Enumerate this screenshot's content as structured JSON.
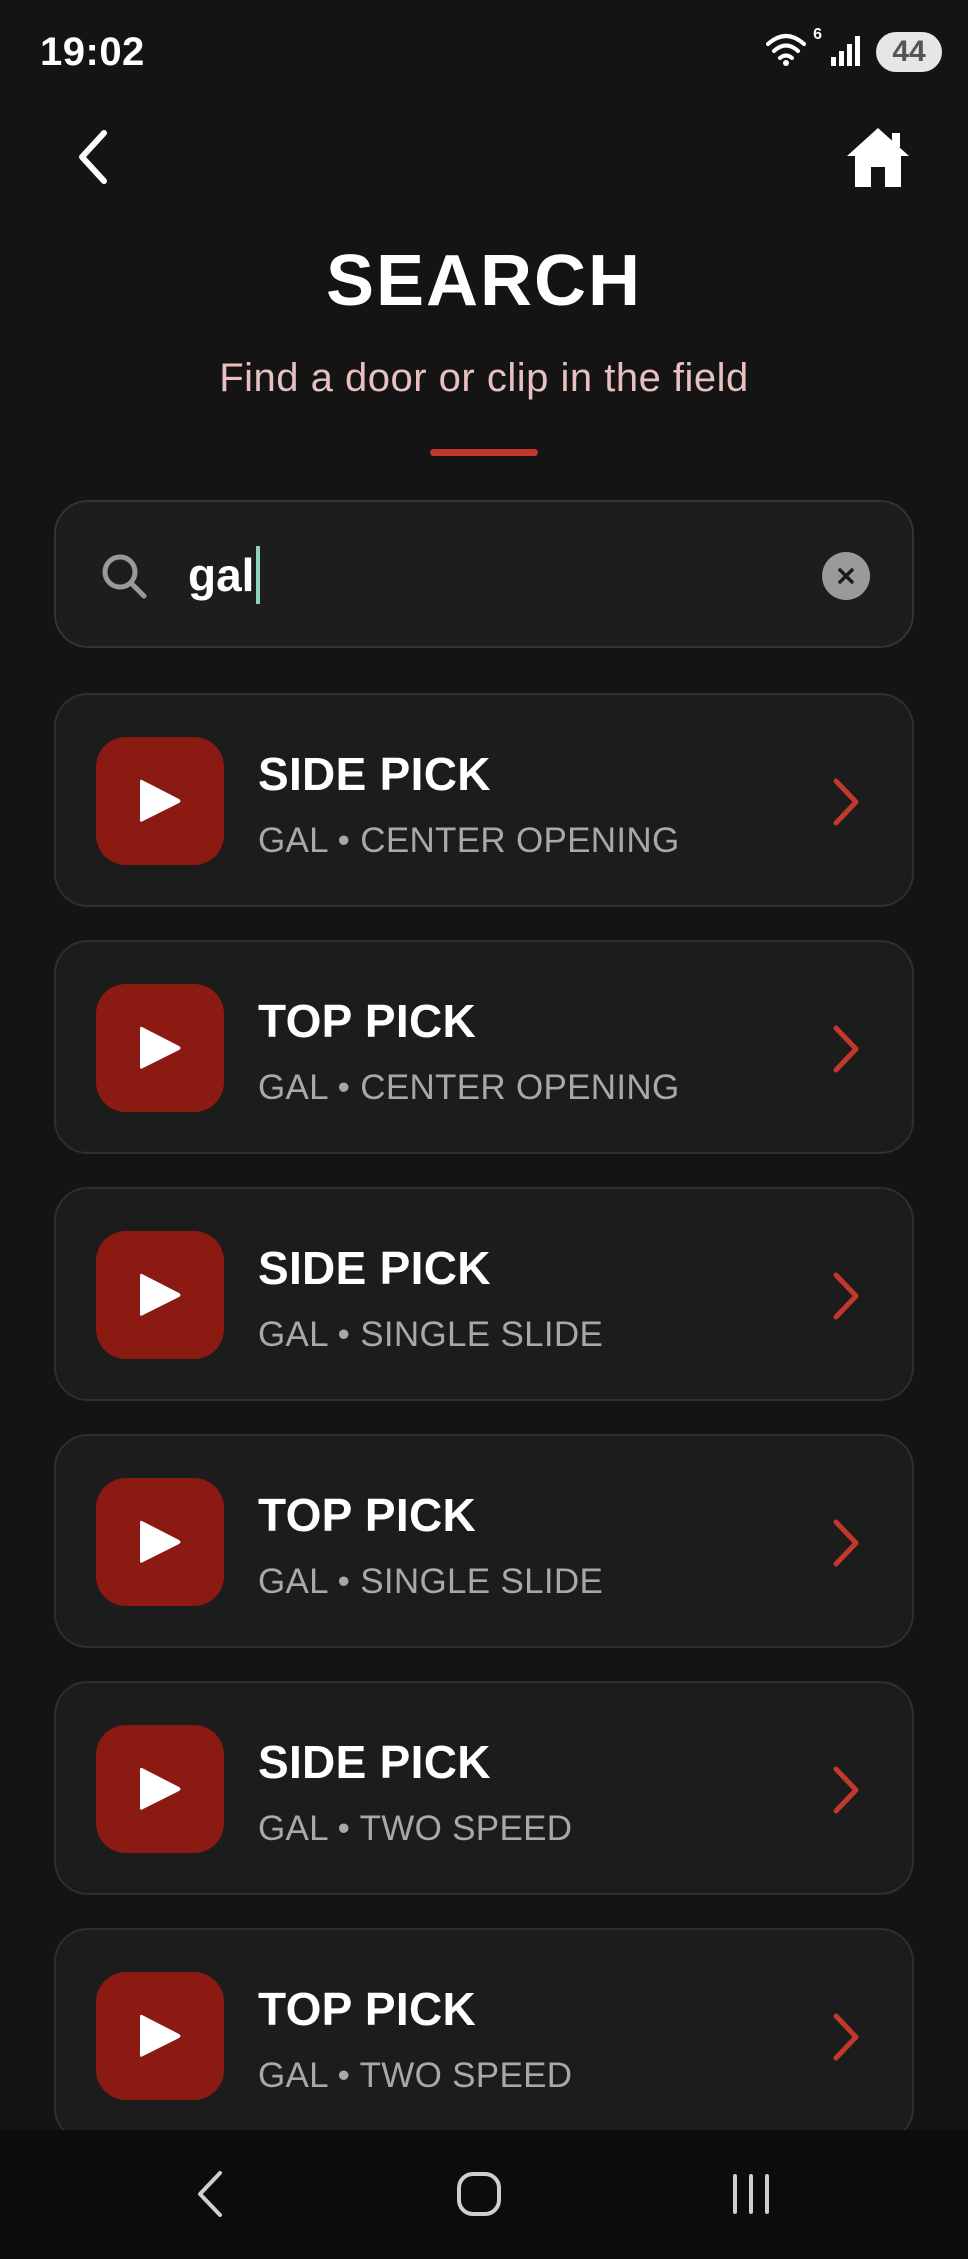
{
  "status_bar": {
    "time": "19:02",
    "wifi_superscript": "6",
    "battery": "44"
  },
  "header": {
    "title": "SEARCH",
    "subtitle": "Find a door or clip in the field",
    "accent_color": "#c0392b"
  },
  "search": {
    "value": "gal",
    "icon": "search-icon",
    "clear_icon": "clear-icon"
  },
  "results": [
    {
      "title": "SIDE PICK",
      "subtitle": "GAL • CENTER OPENING"
    },
    {
      "title": "TOP PICK",
      "subtitle": "GAL • CENTER OPENING"
    },
    {
      "title": "SIDE PICK",
      "subtitle": "GAL • SINGLE SLIDE"
    },
    {
      "title": "TOP PICK",
      "subtitle": "GAL • SINGLE SLIDE"
    },
    {
      "title": "SIDE PICK",
      "subtitle": "GAL • TWO SPEED"
    },
    {
      "title": "TOP PICK",
      "subtitle": "GAL • TWO SPEED"
    }
  ],
  "colors": {
    "background": "#141414",
    "card": "#1c1c1c",
    "play_tile": "#8b1a12",
    "chevron": "#c0392b",
    "subtitle_text": "#e8c0c0"
  },
  "icons": {
    "back": "back-arrow-icon",
    "home": "home-icon",
    "play": "play-icon",
    "chevron": "chevron-right-icon",
    "nav_back": "nav-back-icon",
    "nav_home": "nav-home-icon",
    "nav_recents": "nav-recents-icon"
  }
}
